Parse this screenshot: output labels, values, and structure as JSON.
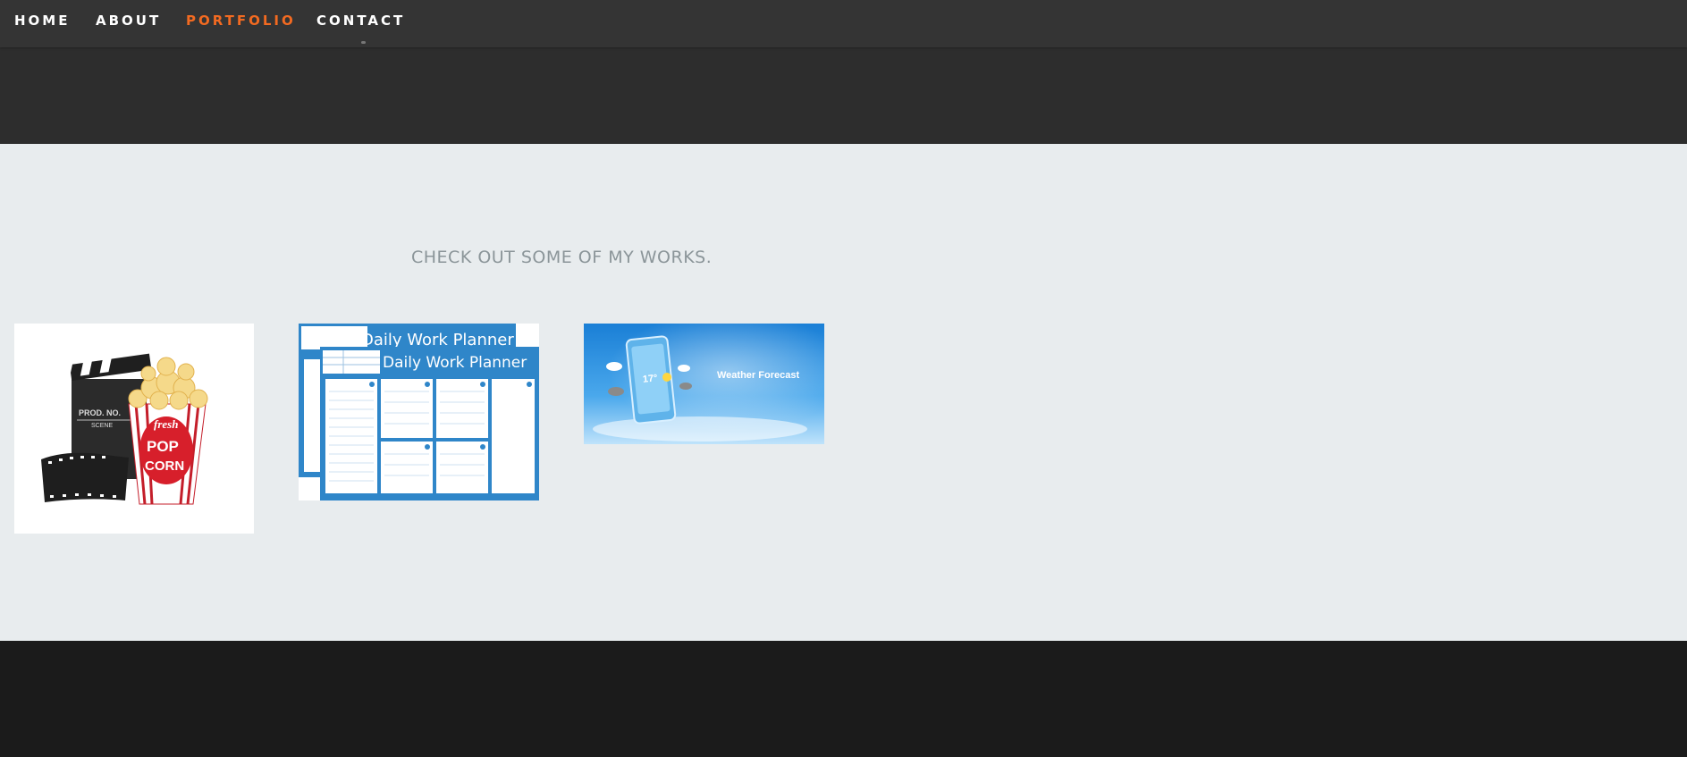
{
  "nav": {
    "items": [
      {
        "label": "HOME",
        "active": false
      },
      {
        "label": "ABOUT",
        "active": false
      },
      {
        "label": "PORTFOLIO",
        "active": true
      },
      {
        "label": "CONTACT",
        "active": false
      }
    ],
    "active_color": "#f26a21"
  },
  "portfolio": {
    "heading": "CHECK OUT SOME OF MY WORKS.",
    "items": [
      {
        "name": "movie-popcorn",
        "image_text": {
          "slate": "PROD. NO.",
          "slate2": "SCENE",
          "box1": "fresh",
          "box2": "POP",
          "box3": "CORN"
        }
      },
      {
        "name": "daily-work-planner",
        "image_text": {
          "title_back": "Daily Work Planner",
          "title_front": "Daily Work Planner"
        }
      },
      {
        "name": "weather-forecast",
        "image_text": {
          "title": "Weather Forecast",
          "temperature": "17°"
        }
      }
    ]
  },
  "colors": {
    "hero_bg": "#2d2d2d",
    "nav_bg": "#343434",
    "section_bg": "#e8ecee",
    "footer_bg": "#1b1b1b",
    "heading_color": "#8b9599"
  }
}
